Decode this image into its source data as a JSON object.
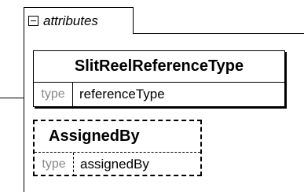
{
  "group": {
    "label": "attributes",
    "toggle_icon": "collapse-minus-icon"
  },
  "elements": [
    {
      "name": "SlitReelReferenceType",
      "type_key": "type",
      "type_value": "referenceType",
      "optional": false
    },
    {
      "name": "AssignedBy",
      "type_key": "type",
      "type_value": "assignedBy",
      "optional": true
    }
  ]
}
